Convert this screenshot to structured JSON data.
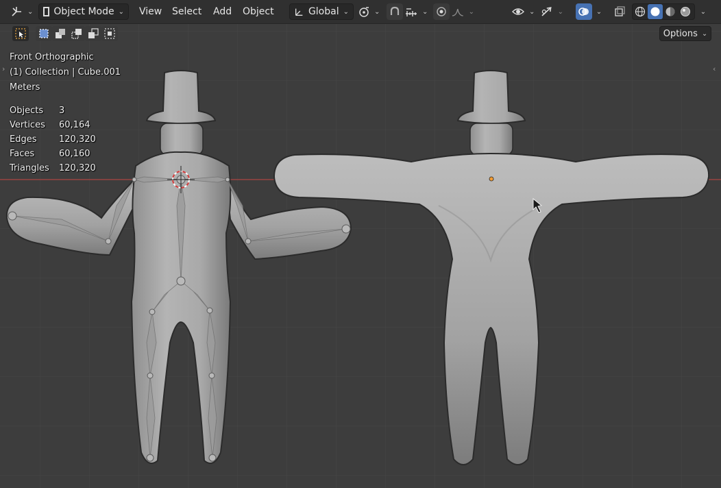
{
  "header": {
    "editor_icon": "axes-editor-icon",
    "mode_label": "Object Mode",
    "menus": [
      "View",
      "Select",
      "Add",
      "Object"
    ],
    "transform_orientation": "Global"
  },
  "toolbar": {
    "options_label": "Options"
  },
  "viewport": {
    "view_name": "Front Orthographic",
    "collection_info": "(1) Collection | Cube.001",
    "units": "Meters",
    "stats": [
      {
        "label": "Objects",
        "value": "3"
      },
      {
        "label": "Vertices",
        "value": "60,164"
      },
      {
        "label": "Edges",
        "value": "120,320"
      },
      {
        "label": "Faces",
        "value": "60,160"
      },
      {
        "label": "Triangles",
        "value": "120,320"
      }
    ]
  },
  "colors": {
    "accent": "#4772b3",
    "background": "#3d3d3d",
    "header": "#303030",
    "x_axis": "#a8423f",
    "origin": "#f39c34"
  }
}
